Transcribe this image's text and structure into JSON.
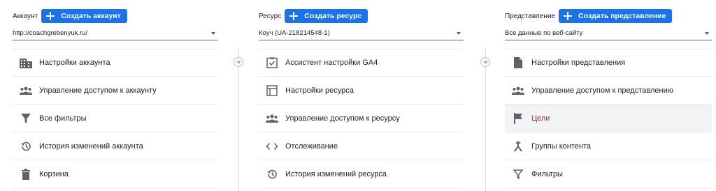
{
  "columns": [
    {
      "title": "Аккаунт",
      "create_label": "Создать аккаунт",
      "selector_value": "http://coachgrebenyuk.ru/",
      "items": [
        {
          "label": "Настройки аккаунта",
          "icon": "building-icon"
        },
        {
          "label": "Управление доступом к аккаунту",
          "icon": "people-icon"
        },
        {
          "label": "Все фильтры",
          "icon": "filter-icon"
        },
        {
          "label": "История изменений аккаунта",
          "icon": "history-icon"
        },
        {
          "label": "Корзина",
          "icon": "trash-icon"
        }
      ]
    },
    {
      "title": "Ресурс",
      "create_label": "Создать ресурс",
      "selector_value": "Коуч (UA-218214548-1)",
      "items": [
        {
          "label": "Ассистент настройки GA4",
          "icon": "checkbox-icon"
        },
        {
          "label": "Настройки ресурса",
          "icon": "layout-icon"
        },
        {
          "label": "Управление доступом к ресурсу",
          "icon": "people-icon"
        },
        {
          "label": "Отслеживание",
          "icon": "code-icon"
        },
        {
          "label": "История изменений ресурса",
          "icon": "history-icon"
        }
      ]
    },
    {
      "title": "Представление",
      "create_label": "Создать представление",
      "selector_value": "Все данные по веб-сайту",
      "items": [
        {
          "label": "Настройки представления",
          "icon": "document-icon"
        },
        {
          "label": "Управление доступом к представлению",
          "icon": "people-icon"
        },
        {
          "label": "Цели",
          "icon": "flag-icon",
          "active": true
        },
        {
          "label": "Группы контента",
          "icon": "merge-icon"
        },
        {
          "label": "Фильтры",
          "icon": "filter-icon"
        }
      ]
    }
  ],
  "colors": {
    "accent": "#1a73e8",
    "active_item_text": "#c5221f",
    "icon_gray": "#5f6368"
  }
}
